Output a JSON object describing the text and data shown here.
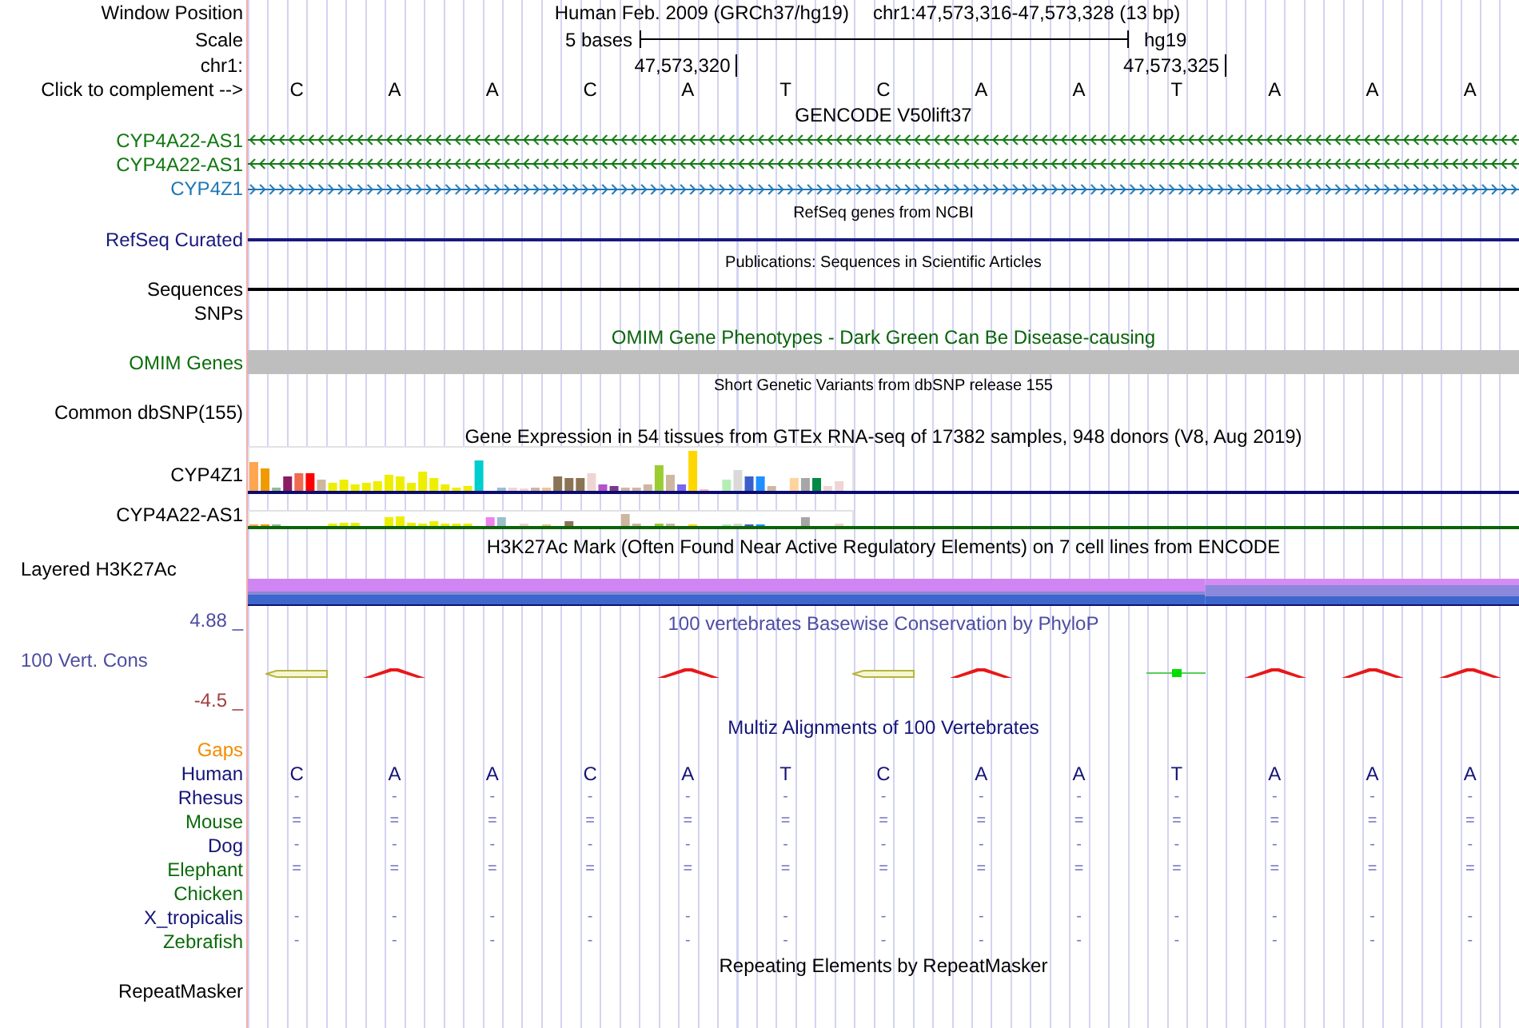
{
  "header": {
    "position_label": "Window Position",
    "assembly": "Human Feb. 2009 (GRCh37/hg19)",
    "range": "chr1:47,573,316-47,573,328 (13 bp)",
    "scale_label": "Scale",
    "scale_span": "5 bases",
    "scale_assembly": "hg19",
    "ruler_label": "chr1:",
    "ruler_ticks": [
      "47,573,320",
      "47,573,325"
    ],
    "sequence_label": "Click to complement -->",
    "bases": [
      "C",
      "A",
      "A",
      "C",
      "A",
      "T",
      "C",
      "A",
      "A",
      "T",
      "A",
      "A",
      "A"
    ]
  },
  "tracks": [
    {
      "kind": "genes",
      "title": "GENCODE V50lift37",
      "color": "#000000",
      "genes": [
        {
          "name": "CYP4A22-AS1",
          "minus_strand": true,
          "color": "#107810"
        },
        {
          "name": "CYP4A22-AS1",
          "minus_strand": true,
          "color": "#107810"
        },
        {
          "name": "CYP4Z1",
          "minus_strand": false,
          "color": "#1f77b4"
        }
      ]
    },
    {
      "kind": "lines",
      "title": "RefSeq genes from NCBI",
      "color": "#000000",
      "rows": [
        {
          "label": "RefSeq Curated",
          "color": "#191980",
          "line": true
        }
      ]
    },
    {
      "kind": "lines",
      "title": "Publications: Sequences in Scientific Articles",
      "color": "#000000",
      "rows": [
        {
          "label": "Sequences",
          "color": "#000000",
          "line": true
        },
        {
          "label": "SNPs",
          "color": "#000000",
          "line": false
        }
      ]
    },
    {
      "kind": "band",
      "title": "OMIM Gene Phenotypes - Dark Green Can Be Disease-causing",
      "color": "#0a640a",
      "rows": [
        {
          "label": "OMIM Genes",
          "color": "#0a6e0a"
        }
      ]
    },
    {
      "kind": "variants",
      "title": "Short Genetic Variants from dbSNP release 155",
      "color": "#000000",
      "rows": [
        {
          "label": "Common dbSNP(155)",
          "color": "#000000"
        }
      ]
    },
    {
      "kind": "expression",
      "title": "Gene Expression in 54 tissues from GTEx RNA-seq of 17382 samples, 948 donors (V8, Aug 2019)",
      "color": "#000000",
      "rows": [
        {
          "label": "CYP4Z1",
          "color": "#0c0c6e"
        },
        {
          "label": "CYP4A22-AS1",
          "color": "#0a640a"
        }
      ]
    },
    {
      "kind": "layered",
      "title": "H3K27Ac Mark (Often Found Near Active Regulatory Elements) on 7 cell lines from ENCODE",
      "color": "#000000",
      "label": "Layered H3K27Ac"
    },
    {
      "kind": "conservation",
      "title": "100 vertebrates Basewise Conservation by PhyloP",
      "color": "#4d4da3",
      "label": "100 Vert. Cons",
      "max": "4.88 _",
      "min": "-4.5 _"
    },
    {
      "kind": "alignment",
      "title": "Multiz Alignments of 100 Vertebrates",
      "color": "#141478",
      "rows": [
        {
          "kind": "gaps",
          "name": "Gaps",
          "color": "#f28c00"
        },
        {
          "kind": "reference",
          "name": "Human",
          "color": "#141478",
          "marks": [
            "C",
            "A",
            "A",
            "C",
            "A",
            "T",
            "C",
            "A",
            "A",
            "T",
            "A",
            "A",
            "A"
          ]
        },
        {
          "kind": "species",
          "name": "Rhesus",
          "color": "#141478",
          "marks": [
            "-",
            "-",
            "-",
            "-",
            "-",
            "-",
            "-",
            "-",
            "-",
            "-",
            "-",
            "-",
            "-"
          ]
        },
        {
          "kind": "species",
          "name": "Mouse",
          "color": "#0b6b0b",
          "marks": [
            "=",
            "=",
            "=",
            "=",
            "=",
            "=",
            "=",
            "=",
            "=",
            "=",
            "=",
            "=",
            "="
          ]
        },
        {
          "kind": "species",
          "name": "Dog",
          "color": "#141478",
          "marks": [
            "-",
            "-",
            "-",
            "-",
            "-",
            "-",
            "-",
            "-",
            "-",
            "-",
            "-",
            "-",
            "-"
          ]
        },
        {
          "kind": "species",
          "name": "Elephant",
          "color": "#0b6b0b",
          "marks": [
            "=",
            "=",
            "=",
            "=",
            "=",
            "=",
            "=",
            "=",
            "=",
            "=",
            "=",
            "=",
            "="
          ]
        },
        {
          "kind": "species",
          "name": "Chicken",
          "color": "#0b6b0b"
        },
        {
          "kind": "species",
          "name": "X_tropicalis",
          "color": "#141478",
          "marks": [
            "-",
            "-",
            "-",
            "-",
            "-",
            "-",
            "-",
            "-",
            "-",
            "-",
            "-",
            "-",
            "-"
          ]
        },
        {
          "kind": "species",
          "name": "Zebrafish",
          "color": "#0b6b0b",
          "marks": [
            "-",
            "-",
            "-",
            "-",
            "-",
            "-",
            "-",
            "-",
            "-",
            "-",
            "-",
            "-",
            "-"
          ]
        }
      ]
    },
    {
      "kind": "repeats",
      "title": "Repeating Elements by RepeatMasker",
      "color": "#000000",
      "rows": [
        {
          "label": "RepeatMasker",
          "color": "#000000"
        }
      ]
    }
  ]
}
